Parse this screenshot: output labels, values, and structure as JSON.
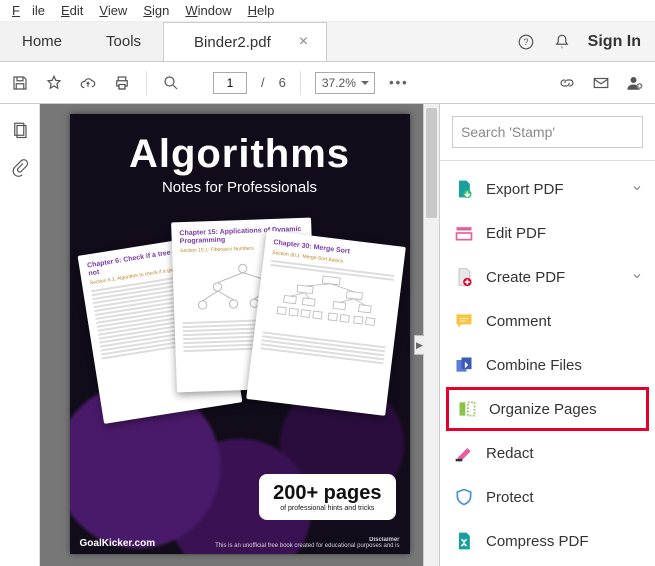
{
  "menubar": {
    "file": "File",
    "edit": "Edit",
    "view": "View",
    "sign": "Sign",
    "window": "Window",
    "help": "Help"
  },
  "tabs": {
    "home": "Home",
    "tools": "Tools",
    "active": "Binder2.pdf",
    "signin": "Sign In"
  },
  "toolbar": {
    "page_current": "1",
    "page_sep": "/",
    "page_total": "6",
    "zoom": "37.2%"
  },
  "rightpanel": {
    "search_placeholder": "Search 'Stamp'",
    "items": [
      {
        "label": "Export PDF",
        "chev": true
      },
      {
        "label": "Edit PDF"
      },
      {
        "label": "Create PDF",
        "chev": true
      },
      {
        "label": "Comment"
      },
      {
        "label": "Combine Files"
      },
      {
        "label": "Organize Pages"
      },
      {
        "label": "Redact"
      },
      {
        "label": "Protect"
      },
      {
        "label": "Compress PDF"
      }
    ]
  },
  "cover": {
    "title": "Algorithms",
    "subtitle": "Notes for Professionals",
    "paper1": {
      "chapter": "Chapter 6: Check if a tree is BST or not",
      "section": "Section 6.1: Algorithm to check if a given binary tree"
    },
    "paper2": {
      "chapter": "Chapter 15: Applications of Dynamic Programming",
      "section": "Section 15.1: Fibonacci Numbers"
    },
    "paper3": {
      "chapter": "Chapter 30: Merge Sort",
      "section": "Section 30.1: Merge Sort Basics"
    },
    "badge": {
      "big": "200+ pages",
      "small": "of professional hints and tricks"
    },
    "footer": {
      "site": "GoalKicker.com",
      "disclaimer_label": "Disclaimer",
      "disclaimer": "This is an unofficial free book created for educational purposes and is"
    }
  }
}
